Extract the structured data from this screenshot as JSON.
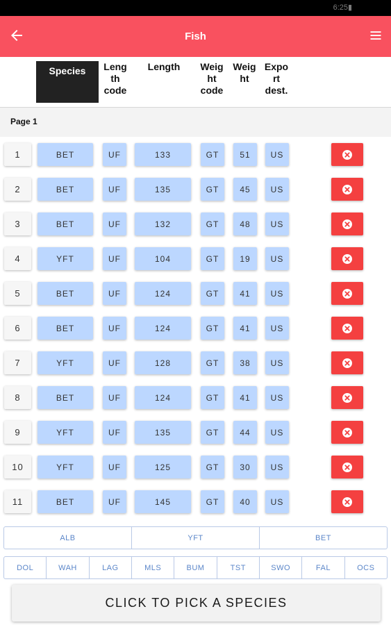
{
  "status_bar": {
    "time": "6:25"
  },
  "app_bar": {
    "title": "Fish"
  },
  "columns": {
    "species": "Species",
    "length_code": "Leng\nth\ncode",
    "length": "Length",
    "weight_code": "Weig\nht\ncode",
    "weight": "Weig\nht",
    "export_dest": "Expo\nrt\ndest."
  },
  "page_label": "Page 1",
  "rows": [
    {
      "n": "1",
      "species": "BET",
      "lcode": "UF",
      "length": "133",
      "wcode": "GT",
      "weight": "51",
      "export": "US"
    },
    {
      "n": "2",
      "species": "BET",
      "lcode": "UF",
      "length": "135",
      "wcode": "GT",
      "weight": "45",
      "export": "US"
    },
    {
      "n": "3",
      "species": "BET",
      "lcode": "UF",
      "length": "132",
      "wcode": "GT",
      "weight": "48",
      "export": "US"
    },
    {
      "n": "4",
      "species": "YFT",
      "lcode": "UF",
      "length": "104",
      "wcode": "GT",
      "weight": "19",
      "export": "US"
    },
    {
      "n": "5",
      "species": "BET",
      "lcode": "UF",
      "length": "124",
      "wcode": "GT",
      "weight": "41",
      "export": "US"
    },
    {
      "n": "6",
      "species": "BET",
      "lcode": "UF",
      "length": "124",
      "wcode": "GT",
      "weight": "41",
      "export": "US"
    },
    {
      "n": "7",
      "species": "YFT",
      "lcode": "UF",
      "length": "128",
      "wcode": "GT",
      "weight": "38",
      "export": "US"
    },
    {
      "n": "8",
      "species": "BET",
      "lcode": "UF",
      "length": "124",
      "wcode": "GT",
      "weight": "41",
      "export": "US"
    },
    {
      "n": "9",
      "species": "YFT",
      "lcode": "UF",
      "length": "135",
      "wcode": "GT",
      "weight": "44",
      "export": "US"
    },
    {
      "n": "10",
      "species": "YFT",
      "lcode": "UF",
      "length": "125",
      "wcode": "GT",
      "weight": "30",
      "export": "US"
    },
    {
      "n": "11",
      "species": "BET",
      "lcode": "UF",
      "length": "145",
      "wcode": "GT",
      "weight": "40",
      "export": "US"
    }
  ],
  "quick_species_primary": [
    "ALB",
    "YFT",
    "BET"
  ],
  "quick_species_secondary": [
    "DOL",
    "WAH",
    "LAG",
    "MLS",
    "BUM",
    "TST",
    "SWO",
    "FAL",
    "OCS"
  ],
  "pick_button": "CLICK TO PICK A SPECIES",
  "colors": {
    "app_bar": "#f9515f",
    "cell_blue": "#bcd7ff",
    "delete": "#f44040"
  },
  "icons": {
    "back": "arrow-left-icon",
    "menu": "hamburger-menu-icon",
    "delete": "close-circle-icon"
  }
}
